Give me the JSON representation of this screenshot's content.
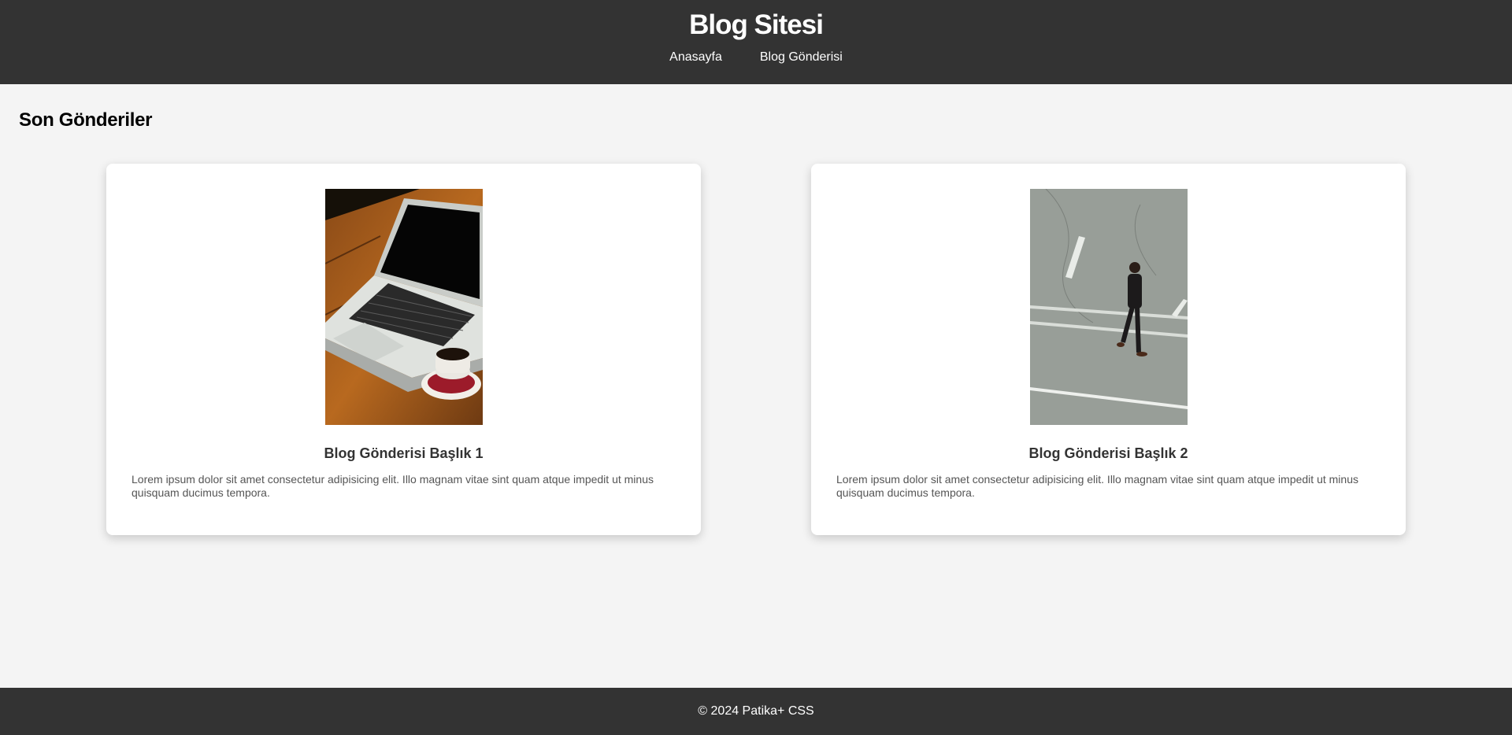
{
  "header": {
    "title": "Blog Sitesi",
    "nav": [
      {
        "label": "Anasayfa"
      },
      {
        "label": "Blog Gönderisi"
      }
    ]
  },
  "main": {
    "section_title": "Son Gönderiler",
    "posts": [
      {
        "title": "Blog Gönderisi Başlık 1",
        "text": "Lorem ipsum dolor sit amet consectetur adipisicing elit. Illo magnam vitae sint quam atque impedit ut minus quisquam ducimus tempora.",
        "image": "laptop-coffee-photo"
      },
      {
        "title": "Blog Gönderisi Başlık 2",
        "text": "Lorem ipsum dolor sit amet consectetur adipisicing elit. Illo magnam vitae sint quam atque impedit ut minus quisquam ducimus tempora.",
        "image": "man-walking-street-photo"
      }
    ]
  },
  "footer": {
    "text": "© 2024 Patika+ CSS"
  },
  "colors": {
    "header_bg": "#333333",
    "page_bg": "#f4f4f4",
    "card_bg": "#ffffff"
  }
}
